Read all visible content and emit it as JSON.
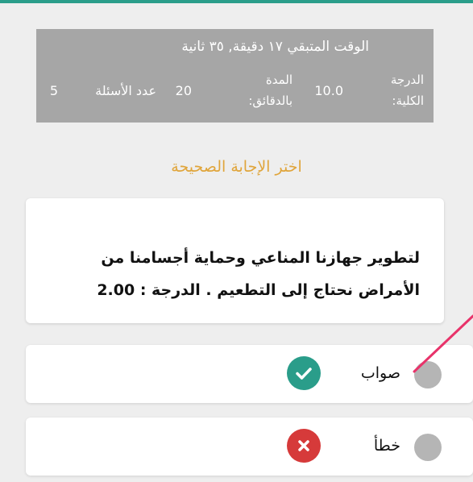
{
  "info": {
    "remaining_time": "الوقت المتبقي ١٧ دقيقة, ٣٥ ثانية",
    "grade_label": "الدرجة الكلية:",
    "grade_value": "10.0",
    "duration_label": "المدة بالدقائق:",
    "duration_value": "20",
    "questions_count_label": "عدد الأسئلة",
    "questions_count_value": "5"
  },
  "instruction": "اختر الإجابة الصحيحة",
  "question": {
    "text": "لتطوير جهازنا المناعي وحماية أجسامنا من الأمراض نحتاج إلى التطعيم . الدرجة : 2.00"
  },
  "options": [
    {
      "label": "صواب",
      "status_icon": "check-icon",
      "status_color": "#2a9d8a"
    },
    {
      "label": "خطأ",
      "status_icon": "close-icon",
      "status_color": "#d63a3a"
    }
  ],
  "colors": {
    "accent": "#2a9d8a",
    "instruction": "#e0a53b",
    "panel": "#a6a6a6",
    "pointer": "#e8336a"
  }
}
